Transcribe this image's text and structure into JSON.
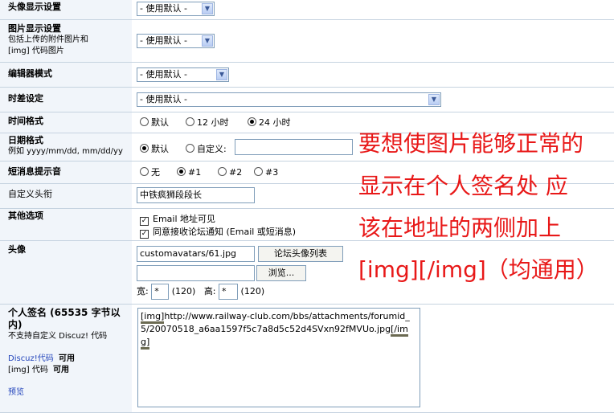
{
  "avatar_display": {
    "label": "头像显示设置",
    "select": "- 使用默认 -"
  },
  "image_display": {
    "label": "图片显示设置",
    "desc1": "包括上传的附件图片和",
    "desc2": "[img] 代码图片",
    "select": "- 使用默认 -"
  },
  "editor_mode": {
    "label": "编辑器模式",
    "select": "- 使用默认 -"
  },
  "timezone": {
    "label": "时差设定",
    "select": "- 使用默认 -"
  },
  "time_format": {
    "label": "时间格式",
    "options": [
      "默认",
      "12 小时",
      "24 小时"
    ],
    "selected_index": 2
  },
  "date_format": {
    "label": "日期格式",
    "desc": "例如  yyyy/mm/dd, mm/dd/yy",
    "options": [
      "默认",
      "自定义:"
    ],
    "selected_index": 0,
    "custom_value": ""
  },
  "pm_sound": {
    "label": "短消息提示音",
    "options": [
      "无",
      "#1",
      "#2",
      "#3"
    ],
    "selected_index": 1
  },
  "custom_title": {
    "label": "自定义头衔",
    "value": "中铁疯狮段段长"
  },
  "other_options": {
    "label": "其他选项",
    "checks": [
      "Email 地址可见",
      "同意接收论坛通知 (Email 或短消息)"
    ]
  },
  "avatar": {
    "label": "头像",
    "path": "customavatars/61.jpg",
    "list_button": "论坛头像列表",
    "browse_button": "浏览...",
    "width_label": "宽:",
    "width_value": "*",
    "width_hint": "(120)",
    "height_label": "高:",
    "height_value": "*",
    "height_hint": "(120)"
  },
  "signature": {
    "label": "个人签名 (65535 字节以内)",
    "desc": "不支持自定义  Discuz! 代码",
    "discuz_code": "Discuz!代码",
    "discuz_code_state": "可用",
    "img_code": "[img] 代码",
    "img_code_state": "可用",
    "preview": "预览",
    "text_open": "[img]",
    "text_body": "http://www.railway-club.com/bbs/attachments/forumid_5/20070518_a6aa1597f5c7a8d5c52d4SVxn92fMVUo.jpg",
    "text_close": "[/img]"
  },
  "annotation": {
    "line1": "要想使图片能够正常的",
    "line2": "显示在个人签名处  应",
    "line3": "该在地址的两侧加上",
    "line4": "[img][/img]（均通用）"
  },
  "colors": {
    "label_bg": "#f1f5fa",
    "border": "#c6d3e0",
    "annotation": "#e81818"
  }
}
